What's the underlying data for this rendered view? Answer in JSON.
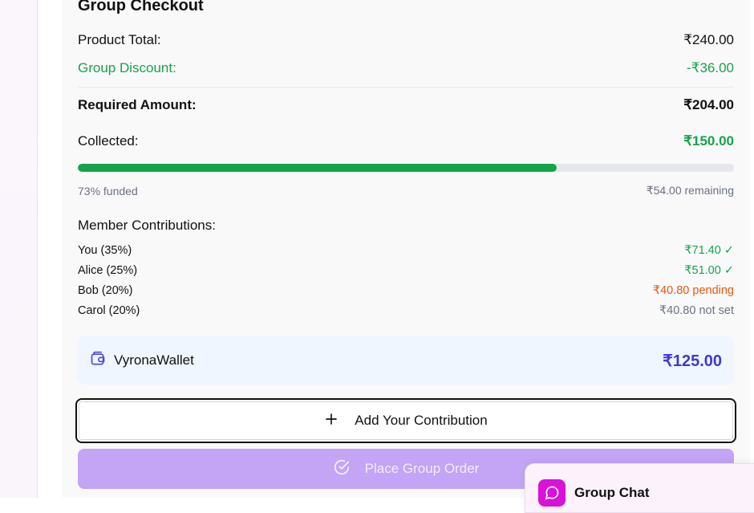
{
  "checkout": {
    "title": "Group Checkout",
    "product_total_label": "Product Total:",
    "product_total_value": "₹240.00",
    "discount_label": "Group Discount:",
    "discount_value": "-₹36.00",
    "required_label": "Required Amount:",
    "required_value": "₹204.00",
    "collected_label": "Collected:",
    "collected_value": "₹150.00",
    "progress_fraction": 0.73,
    "funded_text": "73% funded",
    "remaining_text": "₹54.00 remaining"
  },
  "members": {
    "title": "Member Contributions:",
    "items": [
      {
        "name": "You (35%)",
        "amount": "₹71.40 ✓",
        "status": "paid"
      },
      {
        "name": "Alice (25%)",
        "amount": "₹51.00 ✓",
        "status": "paid"
      },
      {
        "name": "Bob (20%)",
        "amount": "₹40.80 pending",
        "status": "pending"
      },
      {
        "name": "Carol (20%)",
        "amount": "₹40.80 not set",
        "status": "notset"
      }
    ]
  },
  "wallet": {
    "label": "VyronaWallet",
    "balance": "₹125.00",
    "icon": "wallet-icon"
  },
  "actions": {
    "add_contribution_label": "Add Your Contribution",
    "place_order_label": "Place Group Order"
  },
  "chat": {
    "title": "Group Chat",
    "icon": "chat-bubble-icon"
  },
  "colors": {
    "green": "#16a34a",
    "orange": "#ea580c",
    "indigo": "#4338ca",
    "purple_disabled": "#c4a4f5",
    "magenta": "#d911d9"
  }
}
